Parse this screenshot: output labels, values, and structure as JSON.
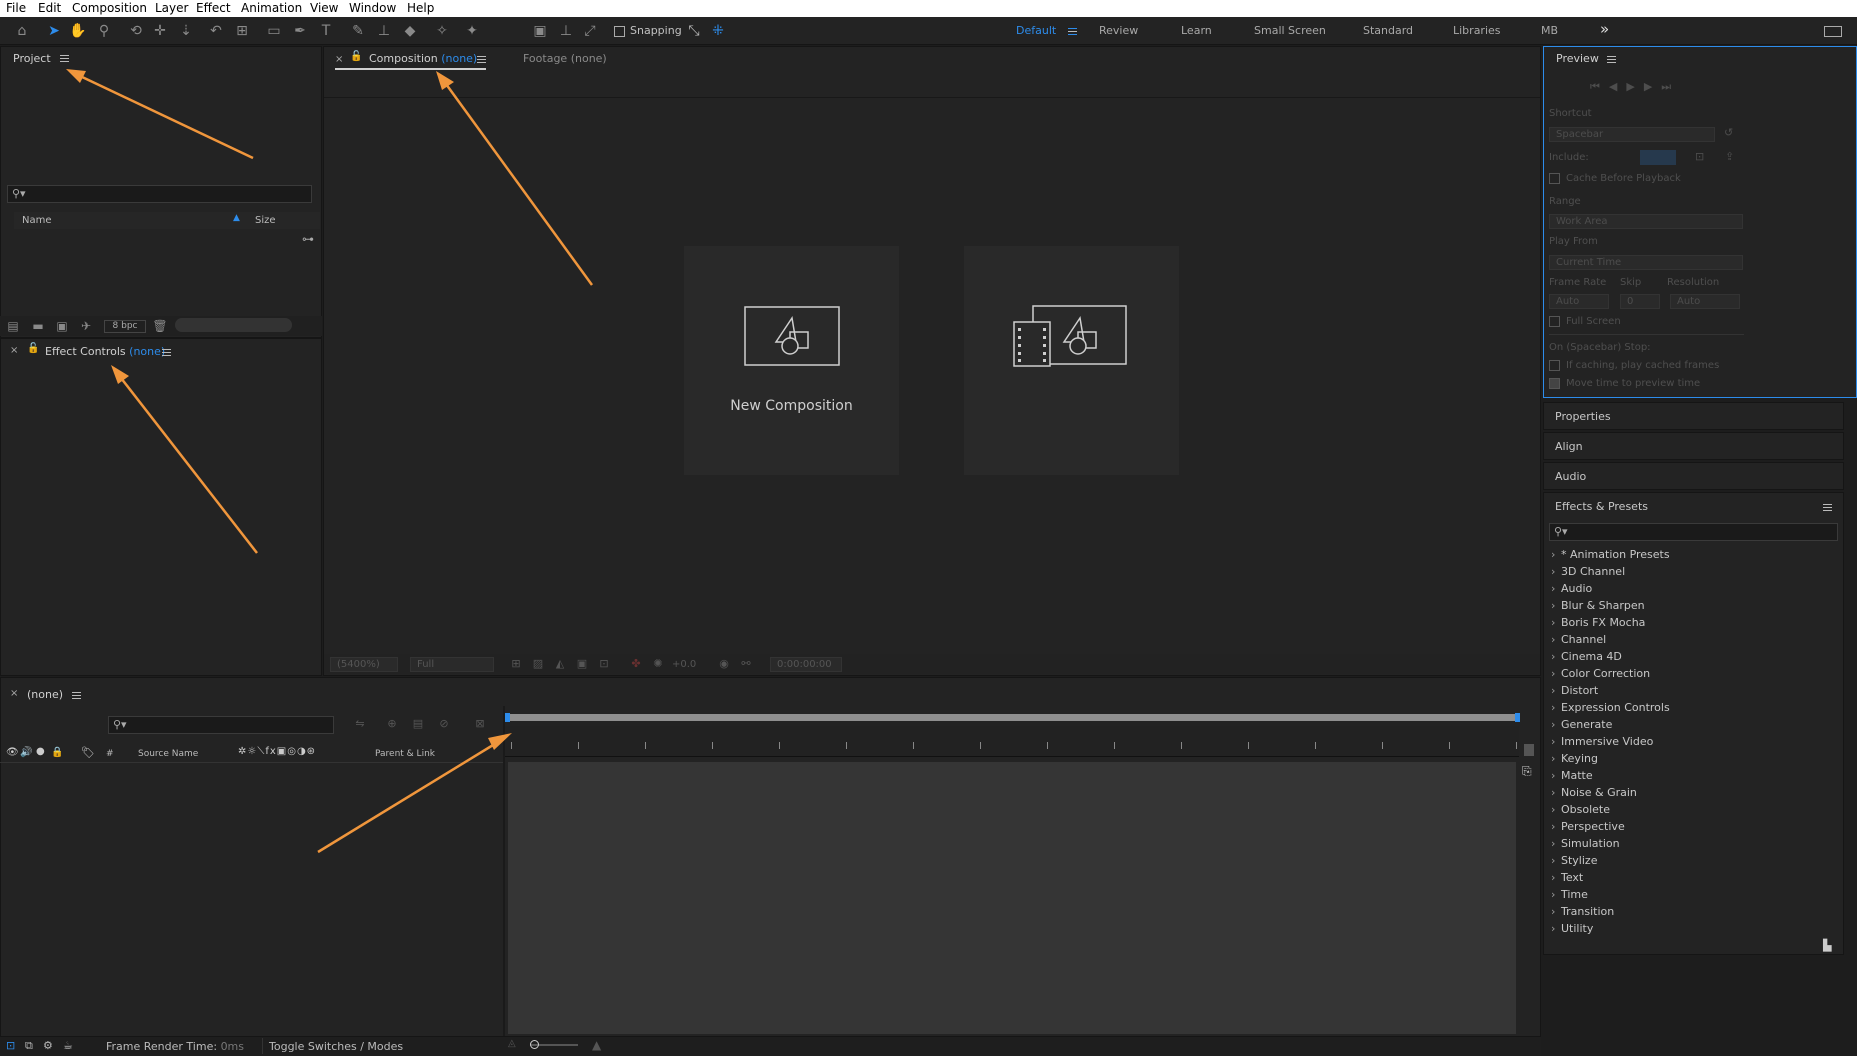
{
  "menu": [
    "File",
    "Edit",
    "Composition",
    "Layer",
    "Effect",
    "Animation",
    "View",
    "Window",
    "Help"
  ],
  "toolbar": {
    "snapping_label": "Snapping",
    "workspaces": [
      "Default",
      "Review",
      "Learn",
      "Small Screen",
      "Standard",
      "Libraries",
      "MB"
    ],
    "active_workspace": "Default",
    "more_glyph": "»"
  },
  "project": {
    "title": "Project",
    "col_name": "Name",
    "col_size": "Size",
    "bpc": "8 bpc"
  },
  "effect_controls": {
    "title": "Effect Controls",
    "suffix": "(none)"
  },
  "composition_panel": {
    "tab_label": "Composition",
    "tab_suffix": "(none)",
    "footage_tab": "Footage",
    "footage_suffix": "(none)",
    "new_comp_label": "New Composition",
    "zoom": "(5400%)",
    "resolution": "Full",
    "exposure": "+0.0",
    "timecode": "0:00:00:00"
  },
  "timeline": {
    "tab_label": "(none)",
    "col_hash": "#",
    "col_source_name": "Source Name",
    "col_parent": "Parent & Link",
    "frame_render_label": "Frame Render Time:",
    "frame_render_value": "0ms",
    "toggle_label": "Toggle Switches / Modes"
  },
  "preview": {
    "title": "Preview",
    "shortcut_label": "Shortcut",
    "shortcut_value": "Spacebar",
    "include_label": "Include:",
    "cache_label": "Cache Before Playback",
    "range_label": "Range",
    "range_value": "Work Area",
    "playfrom_label": "Play From",
    "playfrom_value": "Current Time",
    "framerate_label": "Frame Rate",
    "skip_label": "Skip",
    "resolution_label": "Resolution",
    "framerate_value": "Auto",
    "skip_value": "0",
    "resolution_value": "Auto",
    "fullscreen_label": "Full Screen",
    "onstop_label": "On (Spacebar) Stop:",
    "ifcaching_label": "If caching, play cached frames",
    "movetime_label": "Move time to preview time"
  },
  "side_panels": [
    "Properties",
    "Align",
    "Audio"
  ],
  "effects_presets": {
    "title": "Effects & Presets",
    "items": [
      "* Animation Presets",
      "3D Channel",
      "Audio",
      "Blur & Sharpen",
      "Boris FX Mocha",
      "Channel",
      "Cinema 4D",
      "Color Correction",
      "Distort",
      "Expression Controls",
      "Generate",
      "Immersive Video",
      "Keying",
      "Matte",
      "Noise & Grain",
      "Obsolete",
      "Perspective",
      "Simulation",
      "Stylize",
      "Text",
      "Time",
      "Transition",
      "Utility"
    ]
  },
  "colors": {
    "accent": "#2d8ceb",
    "annotation_arrow": "#f0963c",
    "panel_bg": "#232323"
  }
}
